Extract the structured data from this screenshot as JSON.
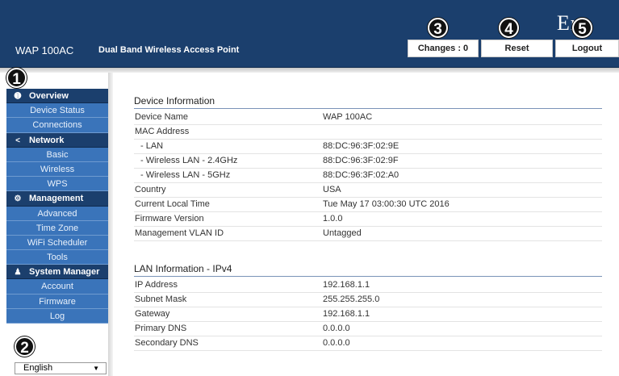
{
  "header": {
    "model": "WAP 100AC",
    "description": "Dual Band Wireless Access Point",
    "brand": "En",
    "buttons": {
      "changes": "Changes : 0",
      "reset": "Reset",
      "logout": "Logout"
    }
  },
  "callouts": [
    "1",
    "2",
    "3",
    "4",
    "5"
  ],
  "sidebar": {
    "sections": [
      {
        "label": "Overview",
        "icon": "info-icon",
        "items": [
          "Device Status",
          "Connections"
        ]
      },
      {
        "label": "Network",
        "icon": "share-icon",
        "items": [
          "Basic",
          "Wireless",
          "WPS"
        ]
      },
      {
        "label": "Management",
        "icon": "gear-icon",
        "items": [
          "Advanced",
          "Time Zone",
          "WiFi Scheduler",
          "Tools"
        ]
      },
      {
        "label": "System Manager",
        "icon": "user-icon",
        "items": [
          "Account",
          "Firmware",
          "Log"
        ]
      }
    ],
    "language": "English"
  },
  "device_info": {
    "title": "Device Information",
    "rows": [
      {
        "key": "Device Name",
        "value": "WAP 100AC"
      },
      {
        "key": "MAC Address",
        "value": ""
      },
      {
        "key": "- LAN",
        "value": "88:DC:96:3F:02:9E"
      },
      {
        "key": "- Wireless LAN - 2.4GHz",
        "value": "88:DC:96:3F:02:9F"
      },
      {
        "key": "- Wireless LAN - 5GHz",
        "value": "88:DC:96:3F:02:A0"
      },
      {
        "key": "Country",
        "value": "USA"
      },
      {
        "key": "Current Local Time",
        "value": "Tue May 17 03:00:30 UTC 2016"
      },
      {
        "key": "Firmware Version",
        "value": "1.0.0"
      },
      {
        "key": "Management VLAN ID",
        "value": "Untagged"
      }
    ]
  },
  "lan_info": {
    "title": "LAN Information - IPv4",
    "rows": [
      {
        "key": "IP Address",
        "value": "192.168.1.1"
      },
      {
        "key": "Subnet Mask",
        "value": "255.255.255.0"
      },
      {
        "key": "Gateway",
        "value": "192.168.1.1"
      },
      {
        "key": "Primary DNS",
        "value": "0.0.0.0"
      },
      {
        "key": "Secondary DNS",
        "value": "0.0.0.0"
      }
    ]
  }
}
